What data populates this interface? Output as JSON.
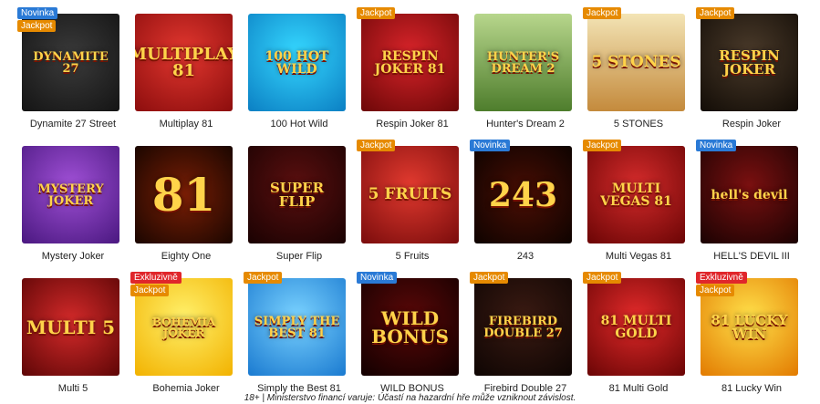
{
  "colors": {
    "Novinka": "#2a7ad6",
    "Jackpot": "#e68a00",
    "Exkluzivně": "#e0262b"
  },
  "games": [
    {
      "title": "Dynamite 27 Street",
      "art": "DYNAMITE 27",
      "art_icon": "dynamite-slot-art",
      "badges": [
        "Novinka",
        "Jackpot"
      ],
      "bg": "radial-gradient(circle at 50% 45%, #3b3b3b, #141414)",
      "fs": 13
    },
    {
      "title": "Multiplay 81",
      "art": "MULTIPLAY 81",
      "art_icon": "multiplay-slot-art",
      "badges": [],
      "bg": "radial-gradient(circle at 50% 40%, #e2372f, #8c0d0d)",
      "fs": 18
    },
    {
      "title": "100 Hot Wild",
      "art": "100 HOT WILD",
      "art_icon": "joker-slot-art",
      "badges": [],
      "bg": "radial-gradient(circle at 50% 40%, #35d7ff, #0b7fc3)",
      "fs": 14
    },
    {
      "title": "Respin Joker 81",
      "art": "RESPIN JOKER 81",
      "art_icon": "joker-mask-slot-art",
      "badges": [
        "Jackpot"
      ],
      "bg": "radial-gradient(circle at 50% 40%, #d8242a, #6c0707)",
      "fs": 14
    },
    {
      "title": "Hunter's Dream 2",
      "art": "HUNTER'S DREAM 2",
      "art_icon": "hunter-slot-art",
      "badges": [],
      "bg": "linear-gradient(#b7d68c, #4e7d2c)",
      "fs": 13
    },
    {
      "title": "5 STONES",
      "art": "5 STONES",
      "art_icon": "pyramid-slot-art",
      "badges": [
        "Jackpot"
      ],
      "bg": "linear-gradient(#f3e4b5, #c48a3c)",
      "fs": 17
    },
    {
      "title": "Respin Joker",
      "art": "RESPIN JOKER",
      "art_icon": "joker-mask-slot-art",
      "badges": [
        "Jackpot"
      ],
      "bg": "radial-gradient(circle at 50% 40%, #4a3a2a, #120c06)",
      "fs": 15
    },
    {
      "title": "Mystery Joker",
      "art": "MYSTERY JOKER",
      "art_icon": "jester-hat-slot-art",
      "badges": [],
      "bg": "radial-gradient(circle at 50% 40%, #a050d6, #4a1880)",
      "fs": 13
    },
    {
      "title": "Eighty One",
      "art": "81",
      "art_icon": "fire-81-slot-art",
      "badges": [],
      "bg": "radial-gradient(circle at 50% 50%, #7a1e05, #1a0600)",
      "fs": 50
    },
    {
      "title": "Super Flip",
      "art": "SUPER FLIP",
      "art_icon": "strawberry-slot-art",
      "badges": [],
      "bg": "radial-gradient(circle at 50% 40%, #5a0f0f, #1a0202)",
      "fs": 15
    },
    {
      "title": "5 Fruits",
      "art": "5 FRUITS",
      "art_icon": "fruits-slot-art",
      "badges": [
        "Jackpot"
      ],
      "bg": "radial-gradient(circle at 50% 40%, #e23a2f, #7a0c0c)",
      "fs": 17
    },
    {
      "title": "243",
      "art": "243",
      "art_icon": "fire-243-slot-art",
      "badges": [
        "Novinka"
      ],
      "bg": "radial-gradient(circle at 50% 50%, #4a0e04, #0e0300)",
      "fs": 36
    },
    {
      "title": "Multi Vegas 81",
      "art": "MULTI VEGAS 81",
      "art_icon": "vegas-slot-art",
      "badges": [
        "Jackpot"
      ],
      "bg": "radial-gradient(circle at 50% 40%, #d42b2b, #6b0505)",
      "fs": 14
    },
    {
      "title": "HELL'S DEVIL III",
      "art": "hell's devil",
      "art_icon": "devil-slot-art",
      "badges": [
        "Novinka"
      ],
      "bg": "radial-gradient(circle at 50% 40%, #7a1010, #1a0202)",
      "fs": 14
    },
    {
      "title": "Multi 5",
      "art": "MULTI 5",
      "art_icon": "neon-5-slot-art",
      "badges": [],
      "bg": "radial-gradient(circle at 50% 45%, #d42a2a, #5e0606)",
      "fs": 20
    },
    {
      "title": "Bohemia Joker",
      "art": "BOHEMIA JOKER",
      "art_icon": "bohemia-joker-slot-art",
      "badges": [
        "Exkluzivně",
        "Jackpot"
      ],
      "bg": "radial-gradient(circle at 50% 40%, #fff06a, #f2b200)",
      "fs": 12
    },
    {
      "title": "Simply the Best 81",
      "art": "SIMPLY THE BEST 81",
      "art_icon": "simply-best-slot-art",
      "badges": [
        "Jackpot"
      ],
      "bg": "radial-gradient(circle at 50% 40%, #7ad2ff, #1a7ad0)",
      "fs": 13
    },
    {
      "title": "WILD BONUS",
      "art": "WILD BONUS",
      "art_icon": "wild-bonus-slot-art",
      "badges": [
        "Novinka"
      ],
      "bg": "radial-gradient(circle at 50% 40%, #5a0808, #120000)",
      "fs": 20
    },
    {
      "title": "Firebird Double 27",
      "art": "FIREBIRD DOUBLE 27",
      "art_icon": "firebird-slot-art",
      "badges": [
        "Jackpot"
      ],
      "bg": "radial-gradient(circle at 50% 40%, #3a1a12, #0e0503)",
      "fs": 13
    },
    {
      "title": "81 Multi Gold",
      "art": "81 MULTI GOLD",
      "art_icon": "multi-gold-slot-art",
      "badges": [
        "Jackpot"
      ],
      "bg": "radial-gradient(circle at 50% 40%, #e22a2a, #6a0505)",
      "fs": 14
    },
    {
      "title": "81 Lucky Win",
      "art": "81 LUCKY WIN",
      "art_icon": "lucky-win-slot-art",
      "badges": [
        "Exkluzivně",
        "Jackpot"
      ],
      "bg": "radial-gradient(circle at 50% 40%, #ffe04a, #e27a00)",
      "fs": 15
    }
  ],
  "footer": "18+ | Ministerstvo financí varuje: Účastí na hazardní hře může vzniknout závislost."
}
